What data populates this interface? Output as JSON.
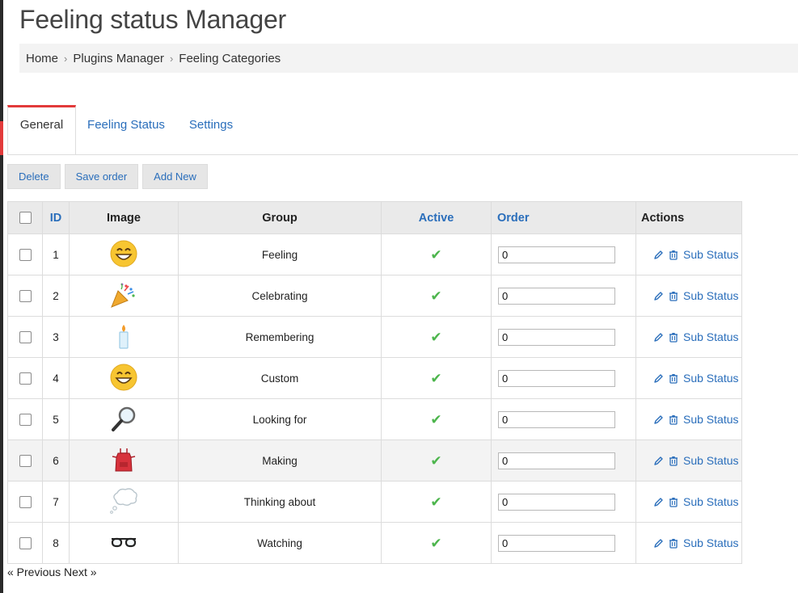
{
  "page": {
    "title": "Feeling status Manager"
  },
  "breadcrumb": [
    "Home",
    "Plugins Manager",
    "Feeling Categories"
  ],
  "tabs": [
    {
      "label": "General",
      "active": true
    },
    {
      "label": "Feeling Status",
      "active": false
    },
    {
      "label": "Settings",
      "active": false
    }
  ],
  "toolbar": {
    "delete_label": "Delete",
    "save_order_label": "Save order",
    "add_new_label": "Add New"
  },
  "table": {
    "headers": {
      "id": "ID",
      "image": "Image",
      "group": "Group",
      "active": "Active",
      "order": "Order",
      "actions": "Actions"
    },
    "rows": [
      {
        "id": "1",
        "image": "grinning-face-icon",
        "group": "Feeling",
        "active": true,
        "order": "0",
        "action_label": "Sub Status"
      },
      {
        "id": "2",
        "image": "party-popper-icon",
        "group": "Celebrating",
        "active": true,
        "order": "0",
        "action_label": "Sub Status"
      },
      {
        "id": "3",
        "image": "candle-icon",
        "group": "Remembering",
        "active": true,
        "order": "0",
        "action_label": "Sub Status"
      },
      {
        "id": "4",
        "image": "grinning-face-icon",
        "group": "Custom",
        "active": true,
        "order": "0",
        "action_label": "Sub Status"
      },
      {
        "id": "5",
        "image": "magnifying-glass-icon",
        "group": "Looking for",
        "active": true,
        "order": "0",
        "action_label": "Sub Status"
      },
      {
        "id": "6",
        "image": "apron-icon",
        "group": "Making",
        "active": true,
        "order": "0",
        "action_label": "Sub Status"
      },
      {
        "id": "7",
        "image": "thought-bubble-icon",
        "group": "Thinking about",
        "active": true,
        "order": "0",
        "action_label": "Sub Status"
      },
      {
        "id": "8",
        "image": "eyeglasses-icon",
        "group": "Watching",
        "active": true,
        "order": "0",
        "action_label": "Sub Status"
      }
    ]
  },
  "pager": {
    "previous_label": "« Previous",
    "next_label": "Next »"
  },
  "colors": {
    "accent": "#e23a3a",
    "link": "#2a6ebb",
    "check": "#4cb54c"
  }
}
